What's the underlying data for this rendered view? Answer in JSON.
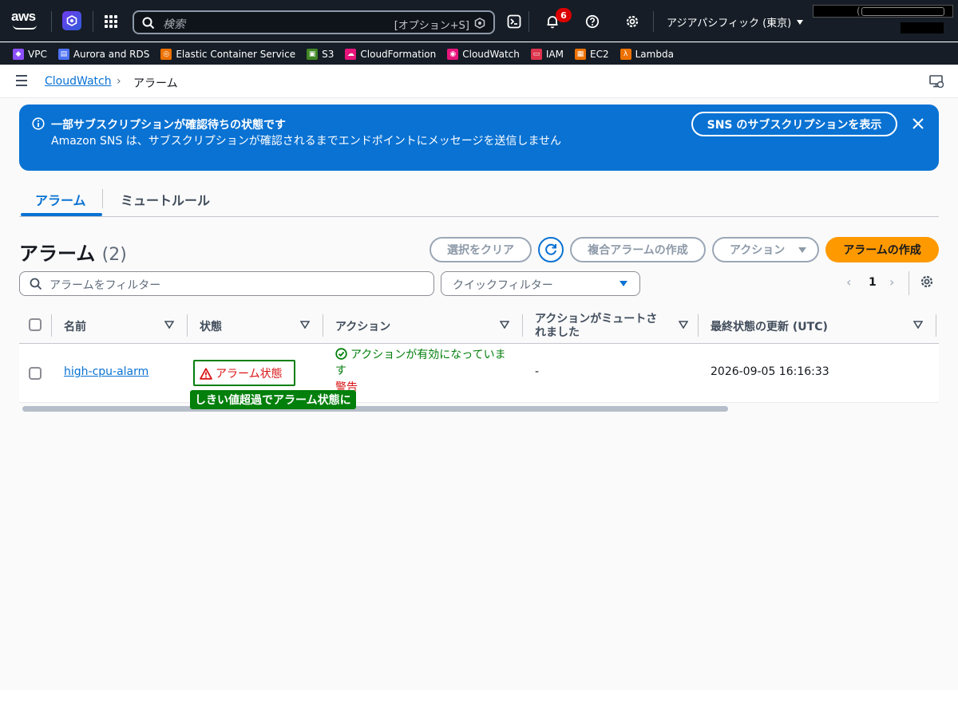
{
  "topnav": {
    "logo_text": "aws",
    "search_placeholder": "検索",
    "search_shortcut": "[オプション+S]",
    "notification_count": "6",
    "region": "アジアパシフィック (東京)",
    "account_paren": "("
  },
  "favorites": [
    {
      "label": "VPC",
      "color": "#8c4fff"
    },
    {
      "label": "Aurora and RDS",
      "color": "#4d72f3"
    },
    {
      "label": "Elastic Container Service",
      "color": "#ed7100"
    },
    {
      "label": "S3",
      "color": "#3f8624"
    },
    {
      "label": "CloudFormation",
      "color": "#e7157b"
    },
    {
      "label": "CloudWatch",
      "color": "#e7157b"
    },
    {
      "label": "IAM",
      "color": "#dd344c"
    },
    {
      "label": "EC2",
      "color": "#ed7100"
    },
    {
      "label": "Lambda",
      "color": "#ed7100"
    }
  ],
  "breadcrumb": {
    "parent": "CloudWatch",
    "current": "アラーム"
  },
  "flash": {
    "heading": "一部サブスクリプションが確認待ちの状態です",
    "body": "Amazon SNS は、サブスクリプションが確認されるまでエンドポイントにメッセージを送信しません",
    "button": "SNS のサブスクリプションを表示"
  },
  "tabs": [
    "アラーム",
    "ミュートルール"
  ],
  "header": {
    "title": "アラーム",
    "count": "(2)",
    "clear_button": "選択をクリア",
    "composite_button": "複合アラームの作成",
    "actions_button": "アクション",
    "create_button": "アラームの作成"
  },
  "filter": {
    "placeholder": "アラームをフィルター",
    "quick_placeholder": "クイックフィルター",
    "page": "1"
  },
  "table": {
    "columns": [
      "名前",
      "状態",
      "アクション",
      "アクションがミュートされました",
      "最終状態の更新 (UTC)"
    ],
    "rows": [
      {
        "name": "high-cpu-alarm",
        "state": "アラーム状態",
        "actions_status": "アクションが有効になっています",
        "actions_warning": "警告",
        "muted": "-",
        "updated": "2026-09-05 16:16:33"
      }
    ],
    "tooltip": "しきい値超過でアラーム状態に"
  },
  "colors": {
    "accent": "#0972d3",
    "primary_button": "#ff9900",
    "nav_bg": "#161d26",
    "alarm_red": "#d91515",
    "ok_green": "#037f0c"
  }
}
